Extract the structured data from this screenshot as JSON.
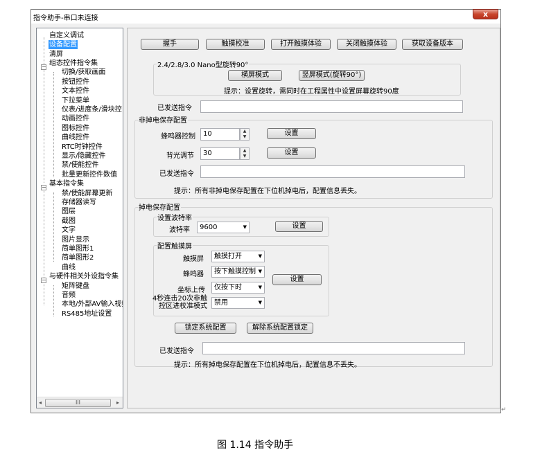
{
  "window": {
    "title": "指令助手-串口未连接",
    "close_glyph": "x"
  },
  "tree": {
    "items": [
      {
        "label": "自定义调试"
      },
      {
        "label": "设备配置"
      },
      {
        "label": "清屏"
      },
      {
        "label": "组态控件指令集"
      },
      {
        "label": "切换/获取画面"
      },
      {
        "label": "按钮控件"
      },
      {
        "label": "文本控件"
      },
      {
        "label": "下拉菜单"
      },
      {
        "label": "仪表/进度条/滑块控"
      },
      {
        "label": "动画控件"
      },
      {
        "label": "图标控件"
      },
      {
        "label": "曲线控件"
      },
      {
        "label": "RTC时钟控件"
      },
      {
        "label": "显示/隐藏控件"
      },
      {
        "label": "禁/使能控件"
      },
      {
        "label": "批量更新控件数值"
      },
      {
        "label": "基本指令集"
      },
      {
        "label": "禁/使能屏幕更新"
      },
      {
        "label": "存储器读写"
      },
      {
        "label": "图层"
      },
      {
        "label": "截图"
      },
      {
        "label": "文字"
      },
      {
        "label": "图片显示"
      },
      {
        "label": "简单图形1"
      },
      {
        "label": "简单图形2"
      },
      {
        "label": "曲线"
      },
      {
        "label": "与硬件相关外设指令集"
      },
      {
        "label": "矩阵键盘"
      },
      {
        "label": "音频"
      },
      {
        "label": "本地/外部AV输入视频"
      },
      {
        "label": "RS485地址设置"
      }
    ],
    "scroll_thumb_glyph": "III"
  },
  "top_buttons": {
    "handshake": "握手",
    "touch_calibrate": "触摸校准",
    "open_touch": "打开触摸体验",
    "close_touch": "关闭触摸体验",
    "get_version": "获取设备版本"
  },
  "rotation": {
    "group_label": "2.4/2.8/3.0 Nano型旋转90°",
    "landscape": "横屏模式",
    "portrait": "竖屏模式(旋转90°)",
    "hint": "提示：设置旋转，需同时在工程属性中设置屏幕旋转90度"
  },
  "sent1": {
    "label": "已发送指令",
    "value": ""
  },
  "volatile": {
    "group_label": "非掉电保存配置",
    "buzzer_label": "蜂鸣器控制",
    "buzzer_value": "10",
    "backlight_label": "背光调节",
    "backlight_value": "30",
    "set_label": "设置",
    "sent_label": "已发送指令",
    "sent_value": "",
    "hint": "提示：所有非掉电保存配置在下位机掉电后，配置信息丢失。"
  },
  "persistent": {
    "group_label": "掉电保存配置",
    "baud_group_label": "设置波特率",
    "baud_label": "波特率",
    "baud_value": "9600",
    "set_label": "设置",
    "touch_group_label": "配置触摸屏",
    "touch_label": "触摸屏",
    "touch_value": "触摸打开",
    "buzzer_label": "蜂鸣器",
    "buzzer_value": "按下触摸控制",
    "coord_label": "坐标上传",
    "coord_value": "仅按下时",
    "calib_label_line1": "4秒连击20次非触",
    "calib_label_line2": "控区进校准模式",
    "calib_value": "禁用",
    "lock_label": "锁定系统配置",
    "unlock_label": "解除系统配置锁定",
    "sent_label": "已发送指令",
    "sent_value": "",
    "hint": "提示：所有掉电保存配置在下位机掉电后，配置信息不丢失。"
  },
  "caption": "图 1.14 指令助手",
  "return_mark": "↵"
}
